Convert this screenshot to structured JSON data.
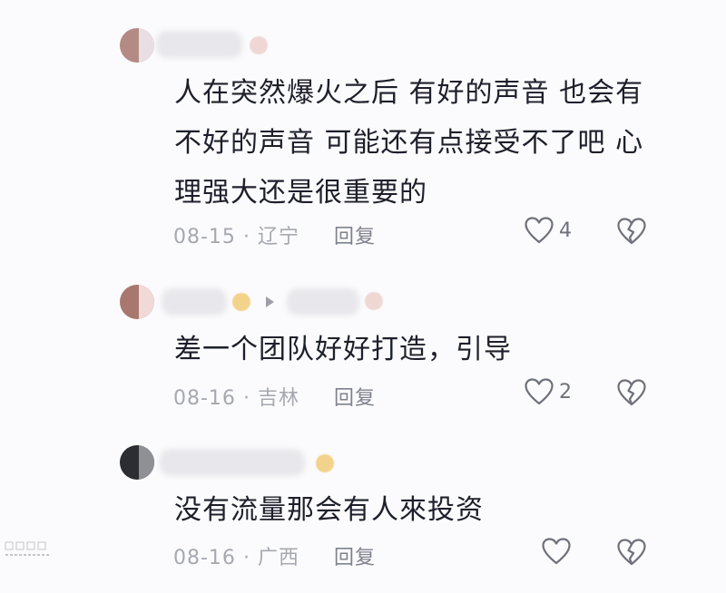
{
  "comments": [
    {
      "text": "人在突然爆火之后 有好的声音 也会有不好的声音 可能还有点接受不了吧 心理强大还是很重要的",
      "date": "08-15",
      "separator": "·",
      "location": "辽宁",
      "reply_label": "回复",
      "likes": "4"
    },
    {
      "text": "差一个团队好好打造，引导",
      "date": "08-16",
      "separator": "·",
      "location": "吉林",
      "reply_label": "回复",
      "likes": "2"
    },
    {
      "text": "没有流量那会有人來投资",
      "date": "08-16",
      "separator": "·",
      "location": "广西",
      "reply_label": "回复",
      "likes": ""
    }
  ],
  "colors": {
    "background": "#fbfbfd",
    "text": "#1d1f2a",
    "meta": "#a6a8b0",
    "icon": "#6e707a"
  }
}
